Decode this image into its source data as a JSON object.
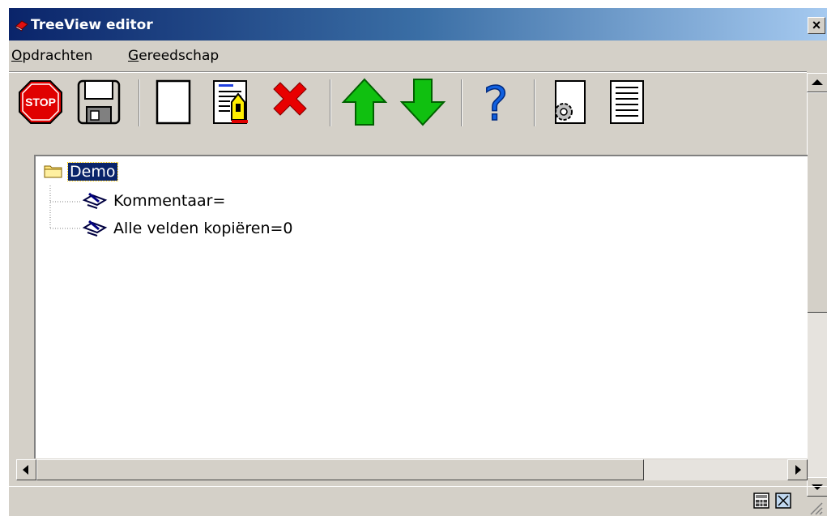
{
  "window": {
    "title": "TreeView editor",
    "close_symbol": "×"
  },
  "menu": {
    "items": [
      {
        "first": "O",
        "rest": "pdrachten"
      },
      {
        "first": "G",
        "rest": "ereedschap"
      }
    ]
  },
  "toolbar": {
    "buttons": [
      {
        "name": "stop-button",
        "icon": "stop-icon",
        "label": "STOP"
      },
      {
        "name": "save-button",
        "icon": "floppy-disk-icon"
      },
      {
        "name": "new-button",
        "icon": "blank-page-icon"
      },
      {
        "name": "edit-button",
        "icon": "edit-document-icon"
      },
      {
        "name": "delete-button",
        "icon": "red-x-icon"
      },
      {
        "name": "move-up-button",
        "icon": "green-up-arrow-icon"
      },
      {
        "name": "move-down-button",
        "icon": "green-down-arrow-icon"
      },
      {
        "name": "help-button",
        "icon": "question-mark-icon",
        "label": "?"
      },
      {
        "name": "settings-button",
        "icon": "gear-document-icon"
      },
      {
        "name": "list-button",
        "icon": "list-document-icon"
      }
    ]
  },
  "tree": {
    "root": "Demo",
    "children": [
      "Kommentaar=",
      "Alle velden kopiëren=0"
    ]
  },
  "colors": {
    "title_start": "#0a246a",
    "title_end": "#a6caf0",
    "selection": "#0a246a",
    "face": "#d4d0c8"
  }
}
